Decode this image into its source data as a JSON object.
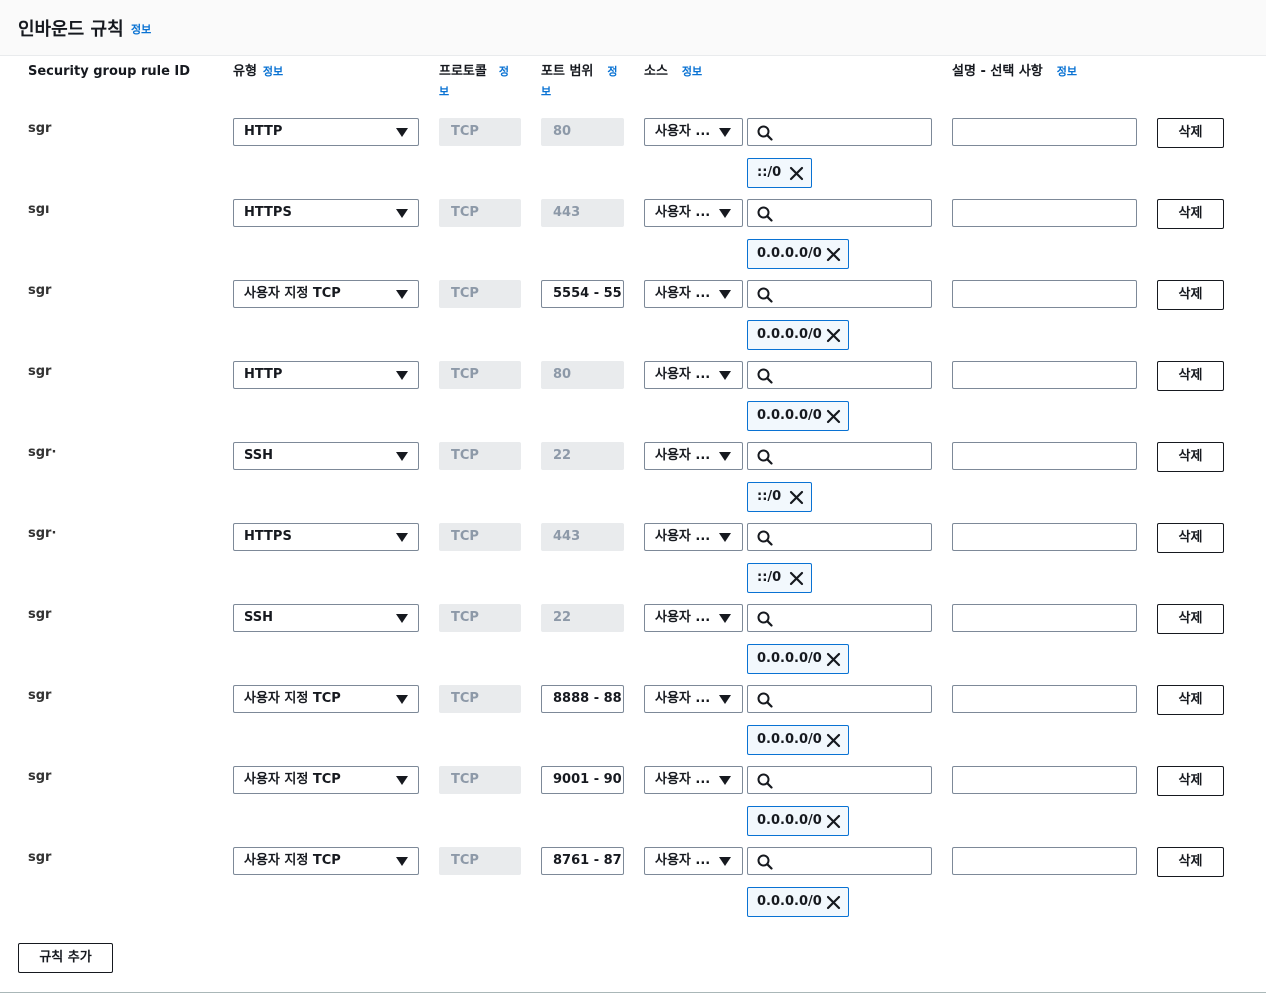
{
  "header": {
    "title": "인바운드 규칙",
    "info": "정보"
  },
  "columns": {
    "rule_id": "Security group rule ID",
    "type": "유형",
    "type_info": "정보",
    "protocol": "프로토콜",
    "protocol_info_1": "정",
    "protocol_info_2": "보",
    "port": "포트 범위",
    "port_info_1": "정",
    "port_info_2": "보",
    "source": "소스",
    "source_info": "정보",
    "description": "설명 - 선택 사항",
    "description_info": "정보"
  },
  "rules": [
    {
      "id": "sgr",
      "type": "HTTP",
      "protocol": "TCP",
      "port": "80",
      "port_editable": false,
      "source": "사용자 ...",
      "cidr": "::/0",
      "delete": "삭제"
    },
    {
      "id": "sgı",
      "type": "HTTPS",
      "protocol": "TCP",
      "port": "443",
      "port_editable": false,
      "source": "사용자 ...",
      "cidr": "0.0.0.0/0",
      "delete": "삭제"
    },
    {
      "id": "sgr",
      "type": "사용자 지정 TCP",
      "protocol": "TCP",
      "port": "5554 - 55",
      "port_editable": true,
      "source": "사용자 ...",
      "cidr": "0.0.0.0/0",
      "delete": "삭제"
    },
    {
      "id": "sgr",
      "type": "HTTP",
      "protocol": "TCP",
      "port": "80",
      "port_editable": false,
      "source": "사용자 ...",
      "cidr": "0.0.0.0/0",
      "delete": "삭제"
    },
    {
      "id": "sgr·",
      "type": "SSH",
      "protocol": "TCP",
      "port": "22",
      "port_editable": false,
      "source": "사용자 ...",
      "cidr": "::/0",
      "delete": "삭제"
    },
    {
      "id": "sgr·",
      "type": "HTTPS",
      "protocol": "TCP",
      "port": "443",
      "port_editable": false,
      "source": "사용자 ...",
      "cidr": "::/0",
      "delete": "삭제"
    },
    {
      "id": "sgr",
      "type": "SSH",
      "protocol": "TCP",
      "port": "22",
      "port_editable": false,
      "source": "사용자 ...",
      "cidr": "0.0.0.0/0",
      "delete": "삭제"
    },
    {
      "id": "sgr",
      "type": "사용자 지정 TCP",
      "protocol": "TCP",
      "port": "8888 - 88",
      "port_editable": true,
      "source": "사용자 ...",
      "cidr": "0.0.0.0/0",
      "delete": "삭제"
    },
    {
      "id": "sgr",
      "type": "사용자 지정 TCP",
      "protocol": "TCP",
      "port": "9001 - 90",
      "port_editable": true,
      "source": "사용자 ...",
      "cidr": "0.0.0.0/0",
      "delete": "삭제"
    },
    {
      "id": "sgr",
      "type": "사용자 지정 TCP",
      "protocol": "TCP",
      "port": "8761 - 87",
      "port_editable": true,
      "source": "사용자 ...",
      "cidr": "0.0.0.0/0",
      "delete": "삭제"
    }
  ],
  "add_rule": "규칙 추가"
}
